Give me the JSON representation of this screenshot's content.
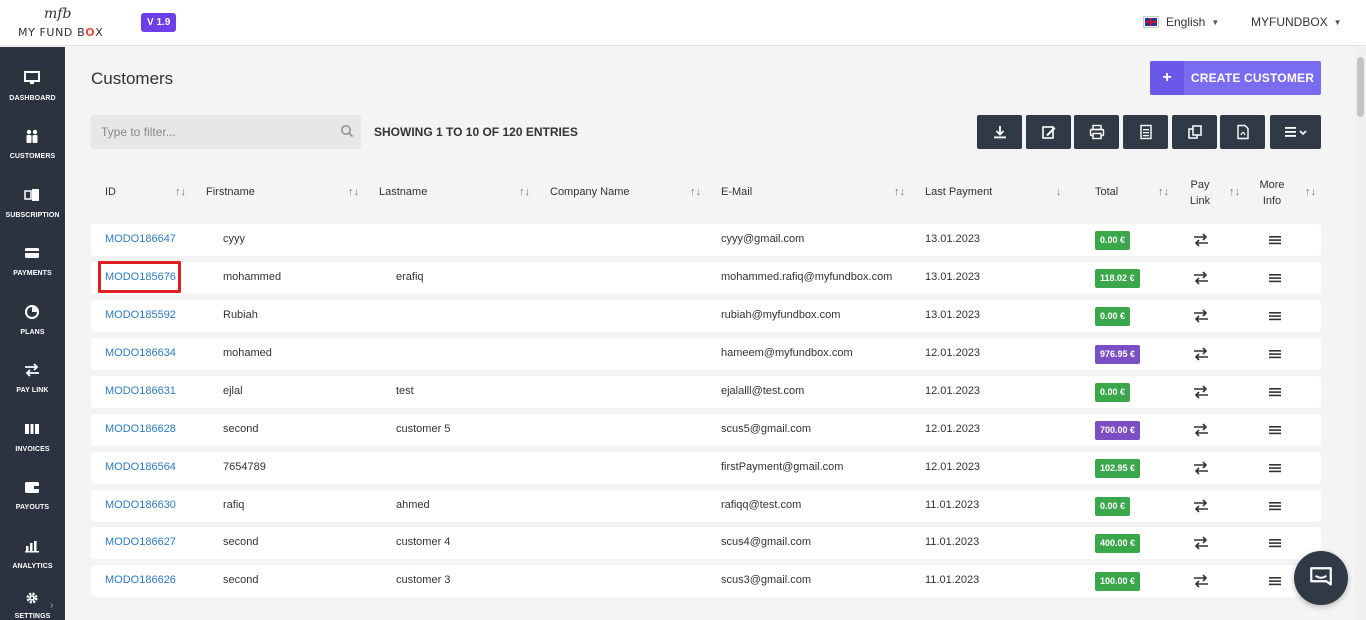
{
  "brand": {
    "logo_text_a": "MY FUND B",
    "logo_text_o": "O",
    "logo_text_b": "X",
    "version": "V 1.9"
  },
  "header": {
    "language": "English",
    "account": "MYFUNDBOX"
  },
  "sidebar": {
    "items": [
      {
        "label": "DASHBOARD",
        "icon": "monitor-icon"
      },
      {
        "label": "CUSTOMERS",
        "icon": "users-icon"
      },
      {
        "label": "SUBSCRIPTION",
        "icon": "subscription-icon"
      },
      {
        "label": "PAYMENTS",
        "icon": "credit-card-icon"
      },
      {
        "label": "PLANS",
        "icon": "plans-icon"
      },
      {
        "label": "PAY LINK",
        "icon": "exchange-icon"
      },
      {
        "label": "INVOICES",
        "icon": "invoices-icon"
      },
      {
        "label": "PAYOUTS",
        "icon": "wallet-icon"
      },
      {
        "label": "ANALYTICS",
        "icon": "bar-chart-icon"
      },
      {
        "label": "SETTINGS",
        "icon": "gear-icon"
      }
    ]
  },
  "page": {
    "title": "Customers",
    "create_label": "CREATE CUSTOMER",
    "filter_placeholder": "Type to filter...",
    "showing": "SHOWING 1 TO 10 OF 120 ENTRIES"
  },
  "table": {
    "headers": {
      "id": "ID",
      "firstname": "Firstname",
      "lastname": "Lastname",
      "company": "Company Name",
      "email": "E-Mail",
      "last_payment": "Last Payment",
      "total": "Total",
      "pay_link_1": "Pay",
      "pay_link_2": "Link",
      "more_info_1": "More",
      "more_info_2": "Info"
    },
    "rows": [
      {
        "id": "MODO186647",
        "first": "cyyy",
        "last": "",
        "company": "",
        "email": "cyyy@gmail.com",
        "date": "13.01.2023",
        "total": "0.00 €",
        "color": "#3aa84a"
      },
      {
        "id": "MODO185676",
        "first": "mohammed",
        "last": "erafiq",
        "company": "",
        "email": "mohammed.rafiq@myfundbox.com",
        "date": "13.01.2023",
        "total": "118.02 €",
        "color": "#3aa84a"
      },
      {
        "id": "MODO185592",
        "first": "Rubiah",
        "last": "",
        "company": "",
        "email": "rubiah@myfundbox.com",
        "date": "13.01.2023",
        "total": "0.00 €",
        "color": "#3aa84a"
      },
      {
        "id": "MODO186634",
        "first": "mohamed",
        "last": "",
        "company": "",
        "email": "hameem@myfundbox.com",
        "date": "12.01.2023",
        "total": "976.95 €",
        "color": "#7b4fc4"
      },
      {
        "id": "MODO186631",
        "first": "ejlal",
        "last": "test",
        "company": "",
        "email": "ejalalll@test.com",
        "date": "12.01.2023",
        "total": "0.00 €",
        "color": "#3aa84a"
      },
      {
        "id": "MODO186628",
        "first": "second",
        "last": "customer 5",
        "company": "",
        "email": "scus5@gmail.com",
        "date": "12.01.2023",
        "total": "700.00 €",
        "color": "#7b4fc4"
      },
      {
        "id": "MODO186564",
        "first": "7654789",
        "last": "",
        "company": "",
        "email": "firstPayment@gmail.com",
        "date": "12.01.2023",
        "total": "102.95 €",
        "color": "#3aa84a"
      },
      {
        "id": "MODO186630",
        "first": "rafiq",
        "last": "ahmed",
        "company": "",
        "email": "rafiqq@test.com",
        "date": "11.01.2023",
        "total": "0.00 €",
        "color": "#3aa84a"
      },
      {
        "id": "MODO186627",
        "first": "second",
        "last": "customer 4",
        "company": "",
        "email": "scus4@gmail.com",
        "date": "11.01.2023",
        "total": "400.00 €",
        "color": "#3aa84a"
      },
      {
        "id": "MODO186626",
        "first": "second",
        "last": "customer 3",
        "company": "",
        "email": "scus3@gmail.com",
        "date": "11.01.2023",
        "total": "100.00 €",
        "color": "#3aa84a"
      }
    ]
  },
  "toolbar_icons": [
    "download-icon",
    "edit-icon",
    "print-icon",
    "csv-icon",
    "copy-icon",
    "pdf-icon",
    "columns-menu-icon"
  ]
}
